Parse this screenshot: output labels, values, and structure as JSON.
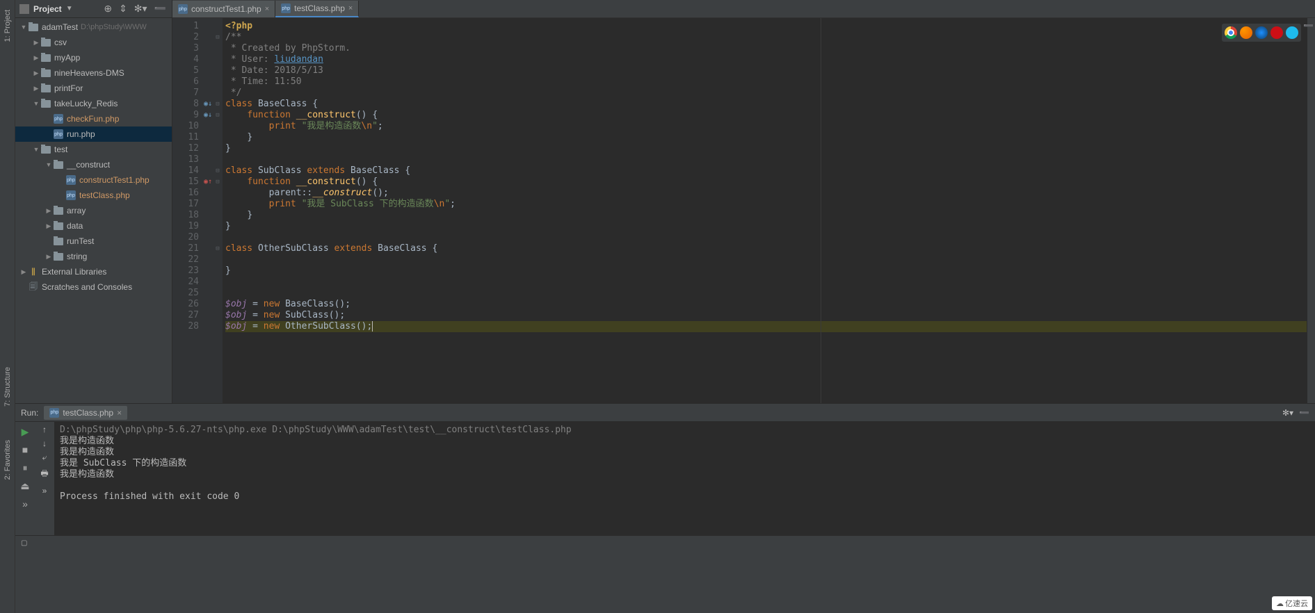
{
  "leftGutter": [
    "1: Project",
    "7: Structure",
    "2: Favorites"
  ],
  "projectPanel": {
    "title": "Project",
    "rootName": "adamTest",
    "rootPath": "D:\\phpStudy\\WWW",
    "tree": [
      {
        "depth": 0,
        "arrow": "▼",
        "icon": "folder",
        "label": "adamTest",
        "path": "D:\\phpStudy\\WWW"
      },
      {
        "depth": 1,
        "arrow": "▶",
        "icon": "folder",
        "label": "csv"
      },
      {
        "depth": 1,
        "arrow": "▶",
        "icon": "folder",
        "label": "myApp"
      },
      {
        "depth": 1,
        "arrow": "▶",
        "icon": "folder",
        "label": "nineHeavens-DMS"
      },
      {
        "depth": 1,
        "arrow": "▶",
        "icon": "folder",
        "label": "printFor"
      },
      {
        "depth": 1,
        "arrow": "▼",
        "icon": "folder",
        "label": "takeLucky_Redis"
      },
      {
        "depth": 2,
        "arrow": "",
        "icon": "php",
        "label": "checkFun.php",
        "hl": true
      },
      {
        "depth": 2,
        "arrow": "",
        "icon": "php",
        "label": "run.php",
        "selected": true
      },
      {
        "depth": 1,
        "arrow": "▼",
        "icon": "folder",
        "label": "test"
      },
      {
        "depth": 2,
        "arrow": "▼",
        "icon": "folder",
        "label": "__construct"
      },
      {
        "depth": 3,
        "arrow": "",
        "icon": "php",
        "label": "constructTest1.php",
        "hl": true
      },
      {
        "depth": 3,
        "arrow": "",
        "icon": "php",
        "label": "testClass.php",
        "hl": true
      },
      {
        "depth": 2,
        "arrow": "▶",
        "icon": "folder",
        "label": "array"
      },
      {
        "depth": 2,
        "arrow": "▶",
        "icon": "folder",
        "label": "data"
      },
      {
        "depth": 2,
        "arrow": "",
        "icon": "folder",
        "label": "runTest"
      },
      {
        "depth": 2,
        "arrow": "▶",
        "icon": "folder",
        "label": "string"
      },
      {
        "depth": 0,
        "arrow": "▶",
        "icon": "lib",
        "label": "External Libraries"
      },
      {
        "depth": 0,
        "arrow": "",
        "icon": "scratch",
        "label": "Scratches and Consoles"
      }
    ]
  },
  "tabs": [
    {
      "name": "constructTest1.php",
      "active": false
    },
    {
      "name": "testClass.php",
      "active": true
    }
  ],
  "code": {
    "lineCount": 28,
    "currentLine": 28,
    "lines": {
      "1": {
        "phpopen": "<?php"
      },
      "2": {
        "cmt": "/**"
      },
      "3": {
        "cmt": " * Created by PhpStorm."
      },
      "4": {
        "cmtPre": " * User: ",
        "link": "liudandan"
      },
      "5": {
        "cmt": " * Date: 2018/5/13"
      },
      "6": {
        "cmt": " * Time: 11:50"
      },
      "7": {
        "cmt": " */"
      },
      "8": {
        "kw1": "class ",
        "cls": "BaseClass ",
        "txt": "{"
      },
      "9": {
        "indent": "    ",
        "kw1": "function ",
        "fn": "__construct",
        "txt": "() {"
      },
      "10": {
        "indent": "        ",
        "kw1": "print ",
        "str": "\"我是构造函数",
        "esc": "\\n",
        "strEnd": "\"",
        "txt": ";"
      },
      "11": {
        "indent": "    ",
        "txt": "}"
      },
      "12": {
        "txt": "}"
      },
      "13": {
        "txt": ""
      },
      "14": {
        "kw1": "class ",
        "cls": "SubClass ",
        "kw2": "extends ",
        "cls2": "BaseClass ",
        "txt": "{"
      },
      "15": {
        "indent": "    ",
        "kw1": "function ",
        "fn": "__construct",
        "txt": "() {"
      },
      "16": {
        "indent": "        ",
        "txt1": "parent::",
        "fnItalic": "__construct",
        "txt2": "();"
      },
      "17": {
        "indent": "        ",
        "kw1": "print ",
        "str": "\"我是 SubClass 下的构造函数",
        "esc": "\\n",
        "strEnd": "\"",
        "txt": ";"
      },
      "18": {
        "indent": "    ",
        "txt": "}"
      },
      "19": {
        "txt": "}"
      },
      "20": {
        "txt": ""
      },
      "21": {
        "kw1": "class ",
        "cls": "OtherSubClass ",
        "kw2": "extends ",
        "cls2": "BaseClass ",
        "txt": "{"
      },
      "22": {
        "txt": ""
      },
      "23": {
        "txt": "}"
      },
      "24": {
        "txt": ""
      },
      "25": {
        "txt": ""
      },
      "26": {
        "var": "$obj",
        "txt1": " = ",
        "kw1": "new ",
        "cls": "BaseClass",
        "txt2": "();"
      },
      "27": {
        "var": "$obj",
        "txt1": " = ",
        "kw1": "new ",
        "cls": "SubClass",
        "txt2": "();"
      },
      "28": {
        "var": "$obj",
        "txt1": " = ",
        "kw1": "new ",
        "cls": "OtherSubClass",
        "txt2": "();"
      }
    },
    "gutterMarks": {
      "8": "◉↓",
      "9": "◉↓",
      "15": "◉↑"
    }
  },
  "run": {
    "label": "Run:",
    "tab": "testClass.php",
    "cmd": "D:\\phpStudy\\php\\php-5.6.27-nts\\php.exe D:\\phpStudy\\WWW\\adamTest\\test\\__construct\\testClass.php",
    "out": [
      "我是构造函数",
      "我是构造函数",
      "我是 SubClass 下的构造函数",
      "我是构造函数",
      "",
      "Process finished with exit code 0"
    ]
  },
  "watermark": "亿速云"
}
